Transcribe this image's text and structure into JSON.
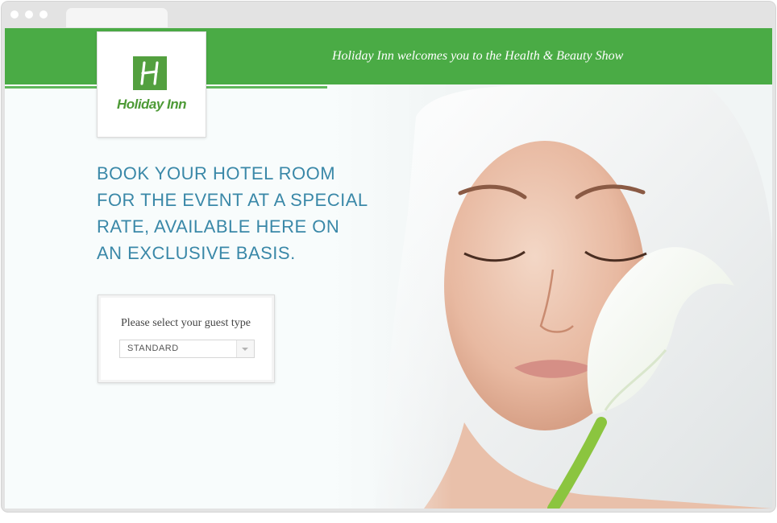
{
  "banner": {
    "welcome_text": "Holiday Inn welcomes you to the Health & Beauty Show",
    "color": "#4aab45"
  },
  "logo": {
    "text": "Holiday Inn",
    "mark_letter": "H",
    "color": "#53a03f"
  },
  "hero": {
    "headline_lines": [
      "BOOK YOUR HOTEL ROOM",
      "FOR THE EVENT AT A SPECIAL",
      "RATE, AVAILABLE HERE ON",
      "AN EXCLUSIVE BASIS."
    ],
    "headline_color": "#3a88a8",
    "image_icon": "spa-woman-with-calla-lily-image"
  },
  "guest_form": {
    "label": "Please select your guest type",
    "selected_value": "STANDARD"
  }
}
